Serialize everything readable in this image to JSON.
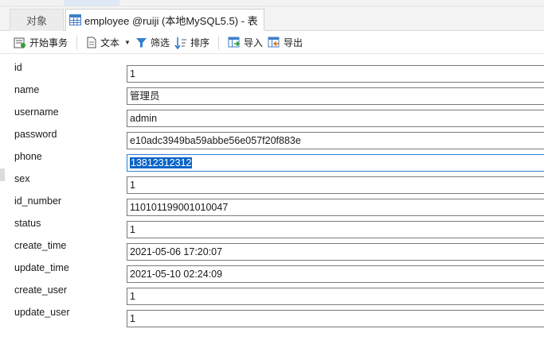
{
  "tabs": {
    "objects_label": "对象",
    "table_label": "employee @ruiji (本地MySQL5.5) - 表"
  },
  "toolbar": {
    "begin_transaction": "开始事务",
    "text": "文本",
    "filter": "筛选",
    "sort": "排序",
    "import": "导入",
    "export": "导出"
  },
  "fields": [
    {
      "label": "id",
      "value": "1"
    },
    {
      "label": "name",
      "value": "管理员"
    },
    {
      "label": "username",
      "value": "admin"
    },
    {
      "label": "password",
      "value": "e10adc3949ba59abbe56e057f20f883e"
    },
    {
      "label": "phone",
      "value": "13812312312"
    },
    {
      "label": "sex",
      "value": "1"
    },
    {
      "label": "id_number",
      "value": "110101199001010047"
    },
    {
      "label": "status",
      "value": "1"
    },
    {
      "label": "create_time",
      "value": "2021-05-06 17:20:07"
    },
    {
      "label": "update_time",
      "value": "2021-05-10 02:24:09"
    },
    {
      "label": "create_user",
      "value": "1"
    },
    {
      "label": "update_user",
      "value": "1"
    }
  ],
  "colors": {
    "selection": "#0a64c8",
    "focus_border": "#2e7fd0",
    "filter_icon": "#2f7fd2"
  }
}
